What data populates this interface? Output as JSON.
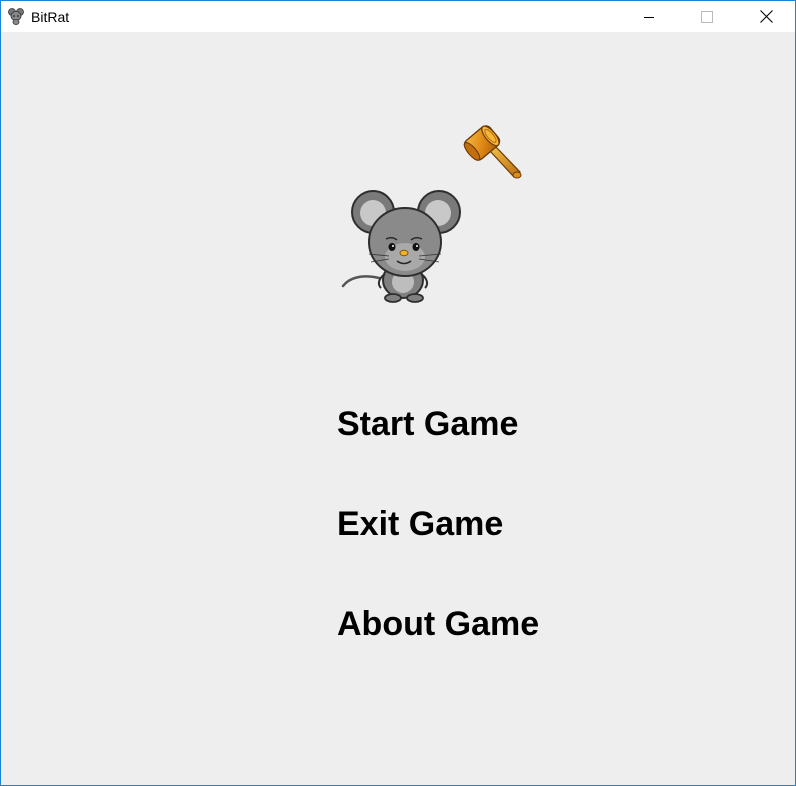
{
  "window": {
    "title": "BitRat",
    "app_icon": "rat-icon",
    "controls": [
      "minimize-icon",
      "maximize-icon",
      "close-icon"
    ]
  },
  "game": {
    "sprites": [
      "hammer-icon",
      "rat-icon"
    ],
    "menu": {
      "start": "Start Game",
      "exit": "Exit Game",
      "about": "About Game"
    }
  },
  "colors": {
    "client_background": "#eeeeee",
    "window_border": "#1883d7",
    "menu_text": "#000000"
  }
}
